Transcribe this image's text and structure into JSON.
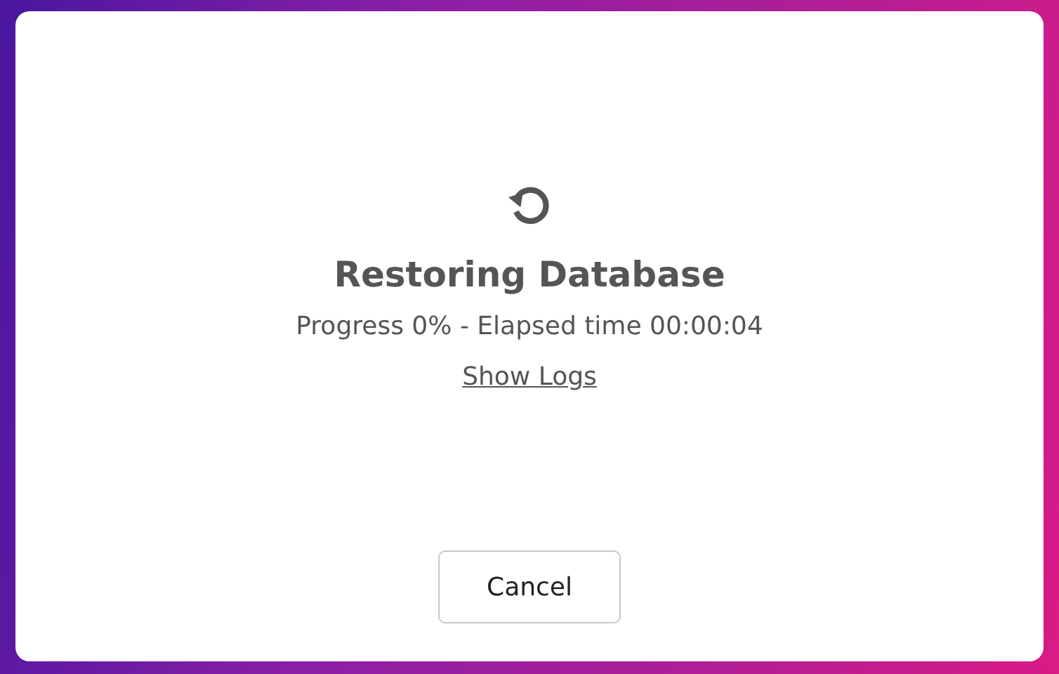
{
  "dialog": {
    "title": "Restoring Database",
    "status": "Progress 0% - Elapsed time 00:00:04",
    "link": "Show Logs",
    "buttons": [
      "Cancel"
    ]
  }
}
